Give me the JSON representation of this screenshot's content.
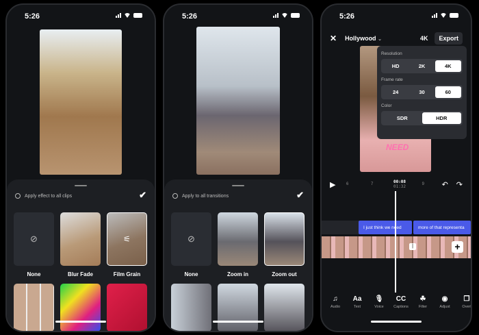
{
  "time": "5:26",
  "phone1": {
    "apply_label": "Apply effect to all clips",
    "effects": [
      {
        "label": "None",
        "icon": "none-icon"
      },
      {
        "label": "Blur Fade"
      },
      {
        "label": "Film Grain",
        "selected": true
      }
    ]
  },
  "phone2": {
    "apply_label": "Apply to all transitions",
    "transitions": [
      {
        "label": "None",
        "icon": "none-icon"
      },
      {
        "label": "Zoom in"
      },
      {
        "label": "Zoom out",
        "selected": true
      }
    ]
  },
  "phone3": {
    "project": "Hollywood",
    "quality": "4K",
    "export": "Export",
    "settings": {
      "resolution_label": "Resolution",
      "resolution": [
        "HD",
        "2K",
        "4K"
      ],
      "frame_rate_label": "Frame rate",
      "frame_rate": [
        "24",
        "30",
        "60"
      ],
      "color_label": "Color",
      "color": [
        "SDR",
        "HDR"
      ]
    },
    "overlay_text": "NEED",
    "timeline": {
      "ticks": [
        "6",
        "7",
        "9"
      ],
      "current": "00:08",
      "total": "01:32"
    },
    "captions": [
      "I just think we need",
      "more of that representa"
    ],
    "tools": [
      {
        "label": "Audio",
        "icon": "♫"
      },
      {
        "label": "Text",
        "icon": "Aa"
      },
      {
        "label": "Voice",
        "icon": "🎙"
      },
      {
        "label": "Captions",
        "icon": "CC"
      },
      {
        "label": "Filter",
        "icon": "☘"
      },
      {
        "label": "Adjust",
        "icon": "◉"
      },
      {
        "label": "Overl",
        "icon": "❐"
      }
    ]
  }
}
